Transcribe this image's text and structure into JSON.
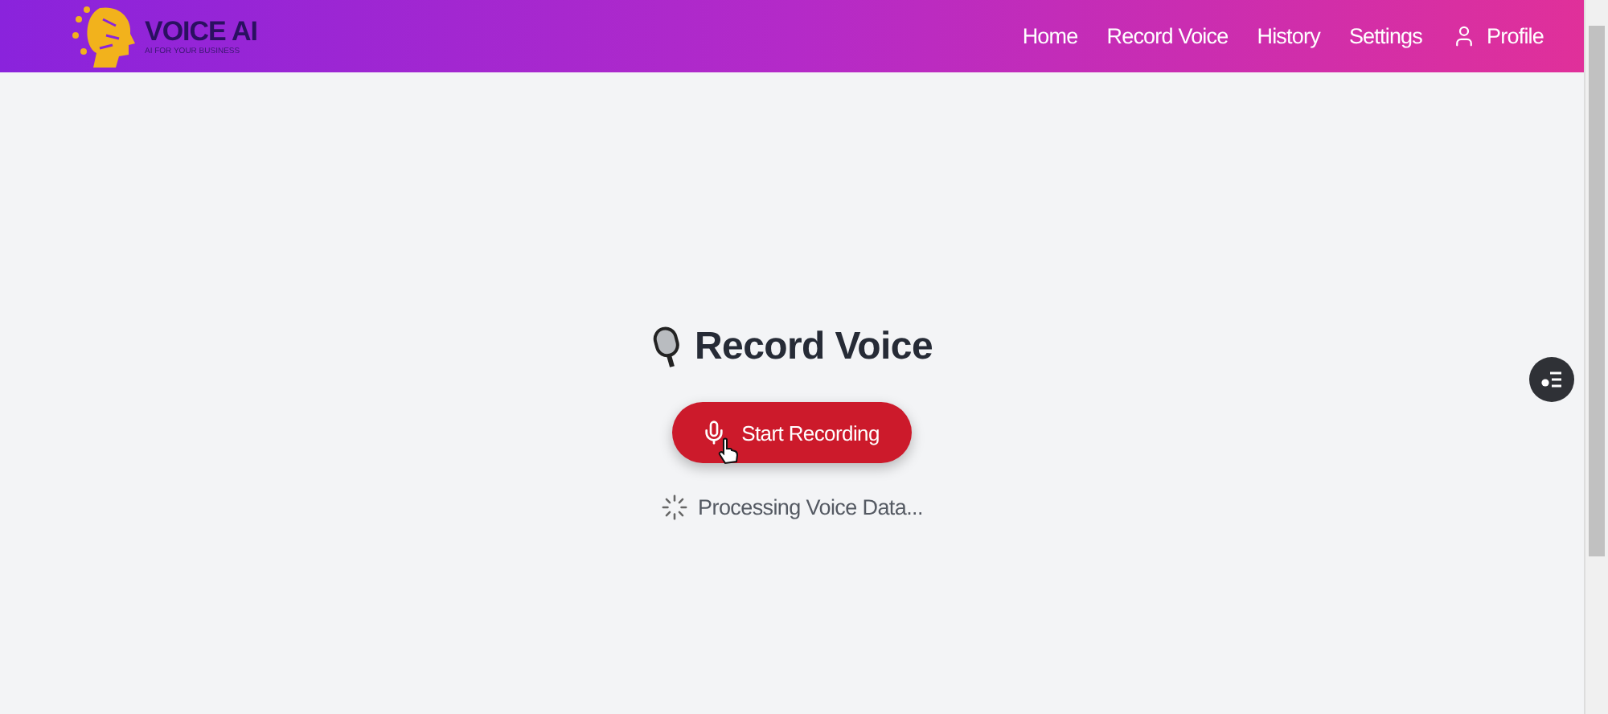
{
  "brand": {
    "name": "VOICE AI",
    "tagline": "AI FOR YOUR BUSINESS"
  },
  "nav": [
    {
      "label": "Home",
      "kind": "link"
    },
    {
      "label": "Record Voice",
      "kind": "link"
    },
    {
      "label": "History",
      "kind": "link"
    },
    {
      "label": "Settings",
      "kind": "link"
    },
    {
      "label": "Profile",
      "kind": "profile"
    }
  ],
  "page": {
    "title": "Record Voice",
    "button": "Start Recording",
    "status": "Processing Voice Data..."
  }
}
